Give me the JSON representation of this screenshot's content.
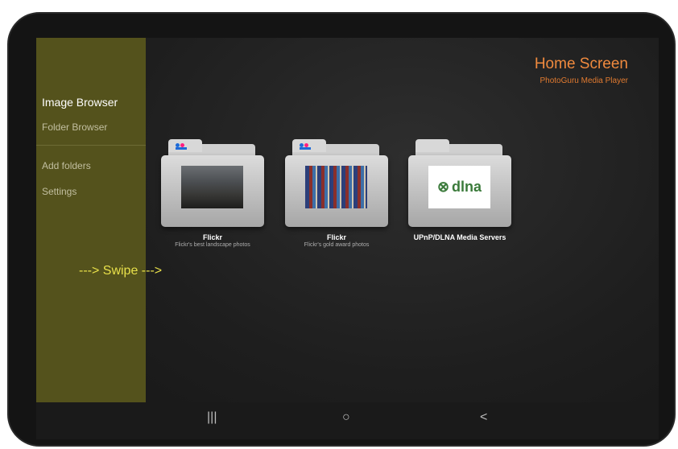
{
  "header": {
    "title": "Home Screen",
    "subtitle": "PhotoGuru Media Player"
  },
  "drawer": {
    "items": [
      {
        "label": "Image Browser",
        "active": true
      },
      {
        "label": "Folder Browser",
        "active": false
      },
      {
        "label": "Add folders",
        "active": false
      },
      {
        "label": "Settings",
        "active": false
      }
    ]
  },
  "folders": [
    {
      "title": "Flickr",
      "subtitle": "Flickr's best landscape photos",
      "icon": "flickr-icon"
    },
    {
      "title": "Flickr",
      "subtitle": "Flickr's gold award photos",
      "icon": "flickr-icon"
    },
    {
      "title": "UPnP/DLNA Media Servers",
      "subtitle": "",
      "thumb_text": "dlna",
      "thumb_glyph": "⊗"
    }
  ],
  "hint": {
    "text": "---> Swipe --->"
  },
  "navbar": {
    "recents_glyph": "|||",
    "home_glyph": "○",
    "back_glyph": "<"
  },
  "colors": {
    "drawer_bg": "#54521c",
    "accent": "#f08a3e",
    "hint": "#e8e04a"
  }
}
